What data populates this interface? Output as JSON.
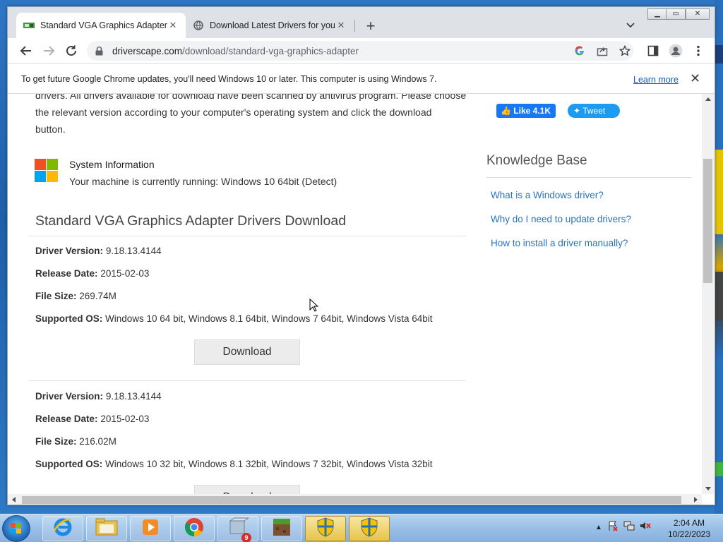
{
  "browser": {
    "tabs": [
      {
        "title": "Standard VGA Graphics Adapter D",
        "active": true
      },
      {
        "title": "Download Latest Drivers for your",
        "active": false
      }
    ],
    "url_domain": "driverscape.com",
    "url_path": "/download/standard-vga-graphics-adapter"
  },
  "infobar": {
    "message": "To get future Google Chrome updates, you'll need Windows 10 or later. This computer is using Windows 7.",
    "learn_more": "Learn more"
  },
  "page": {
    "intro_partial": "drivers. All drivers available for download have been scanned by antivirus program. Please choose",
    "intro_line2": "the relevant version according to your computer's operating system and click the download",
    "intro_line3": "button.",
    "system_info_title": "System Information",
    "system_info_text": "Your machine is currently running: Windows 10 64bit (Detect)",
    "section_title": "Standard VGA Graphics Adapter Drivers Download",
    "drivers": [
      {
        "version_label": "Driver Version:",
        "version": "9.18.13.4144",
        "date_label": "Release Date:",
        "date": "2015-02-03",
        "size_label": "File Size:",
        "size": "269.74M",
        "os_label": "Supported OS:",
        "os": "Windows 10 64 bit, Windows 8.1 64bit, Windows 7 64bit, Windows Vista 64bit",
        "button": "Download"
      },
      {
        "version_label": "Driver Version:",
        "version": "9.18.13.4144",
        "date_label": "Release Date:",
        "date": "2015-02-03",
        "size_label": "File Size:",
        "size": "216.02M",
        "os_label": "Supported OS:",
        "os": "Windows 10 32 bit, Windows 8.1 32bit, Windows 7 32bit, Windows Vista 32bit",
        "button": "Download"
      }
    ]
  },
  "sidebar": {
    "like": "Like 4.1K",
    "tweet": "Tweet",
    "kb_title": "Knowledge Base",
    "links": [
      "What is a Windows driver?",
      "Why do I need to update drivers?",
      "How to install a driver manually?"
    ]
  },
  "taskbar": {
    "time": "2:04 AM",
    "date": "10/22/2023",
    "badge": "9"
  },
  "colors": {
    "link": "#2a74b8",
    "facebook": "#1877f2",
    "twitter": "#1d9bf0"
  }
}
